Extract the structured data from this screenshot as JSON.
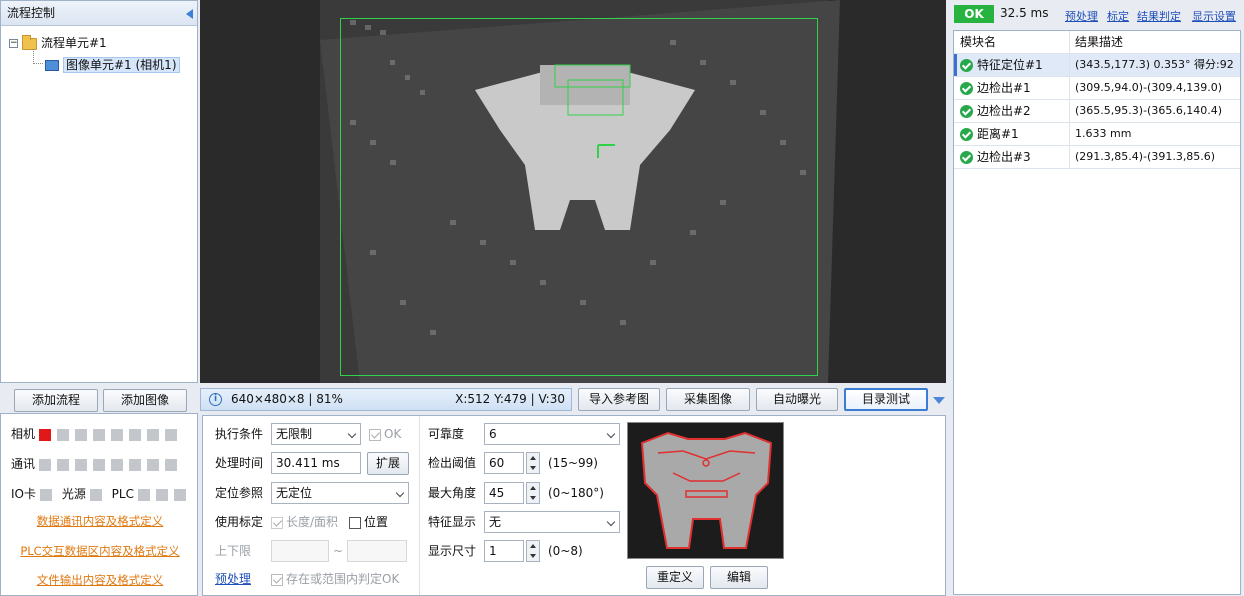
{
  "left_panel": {
    "title": "流程控制",
    "tree": {
      "flow_unit": "流程单元#1",
      "image_unit": "图像单元#1 (相机1)"
    },
    "add_flow": "添加流程",
    "add_image": "添加图像",
    "status": {
      "camera": "相机",
      "comm": "通讯",
      "io": "IO卡",
      "light": "光源",
      "plc": "PLC"
    },
    "links": {
      "data_comm": "数据通讯内容及格式定义",
      "plc_data": "PLC交互数据区内容及格式定义",
      "file_output": "文件输出内容及格式定义"
    }
  },
  "viewer": {
    "image_desc": "PCB inspection image with part",
    "info_left": "640×480×8 | 81%",
    "info_right": "X:512 Y:479 | V:30"
  },
  "toolbar": {
    "import_ref": "导入参考图",
    "capture": "采集图像",
    "auto_exposure": "自动曝光",
    "dir_test": "目录测试"
  },
  "settings": {
    "exec_cond_label": "执行条件",
    "exec_cond_value": "无限制",
    "ok_label": "OK",
    "proc_time_label": "处理时间",
    "proc_time_value": "30.411 ms",
    "expand": "扩展",
    "locate_ref_label": "定位参照",
    "locate_ref_value": "无定位",
    "use_calib_label": "使用标定",
    "length_area": "长度/面积",
    "position": "位置",
    "range_label": "上下限",
    "range_sep": "~",
    "preprocess": "预处理",
    "judge_label": "存在或范围内判定OK",
    "reliability_label": "可靠度",
    "reliability_value": "6",
    "detect_thresh_label": "检出阈值",
    "detect_thresh_value": "60",
    "detect_thresh_range": "(15~99)",
    "max_angle_label": "最大角度",
    "max_angle_value": "45",
    "max_angle_range": "(0~180°)",
    "feature_show_label": "特征显示",
    "feature_show_value": "无",
    "show_size_label": "显示尺寸",
    "show_size_value": "1",
    "show_size_range": "(0~8)",
    "redefine": "重定义",
    "edit": "编辑"
  },
  "results": {
    "status": "OK",
    "time": "32.5 ms",
    "links": [
      "预处理",
      "标定",
      "结果判定",
      "显示设置"
    ],
    "headers": [
      "模块名",
      "结果描述"
    ],
    "rows": [
      {
        "name": "特征定位#1",
        "desc": "(343.5,177.3) 0.353° 得分:92"
      },
      {
        "name": "边检出#1",
        "desc": "(309.5,94.0)-(309.4,139.0)"
      },
      {
        "name": "边检出#2",
        "desc": "(365.5,95.3)-(365.6,140.4)"
      },
      {
        "name": "距离#1",
        "desc": "1.633 mm"
      },
      {
        "name": "边检出#3",
        "desc": "(291.3,85.4)-(391.3,85.6)"
      }
    ]
  }
}
